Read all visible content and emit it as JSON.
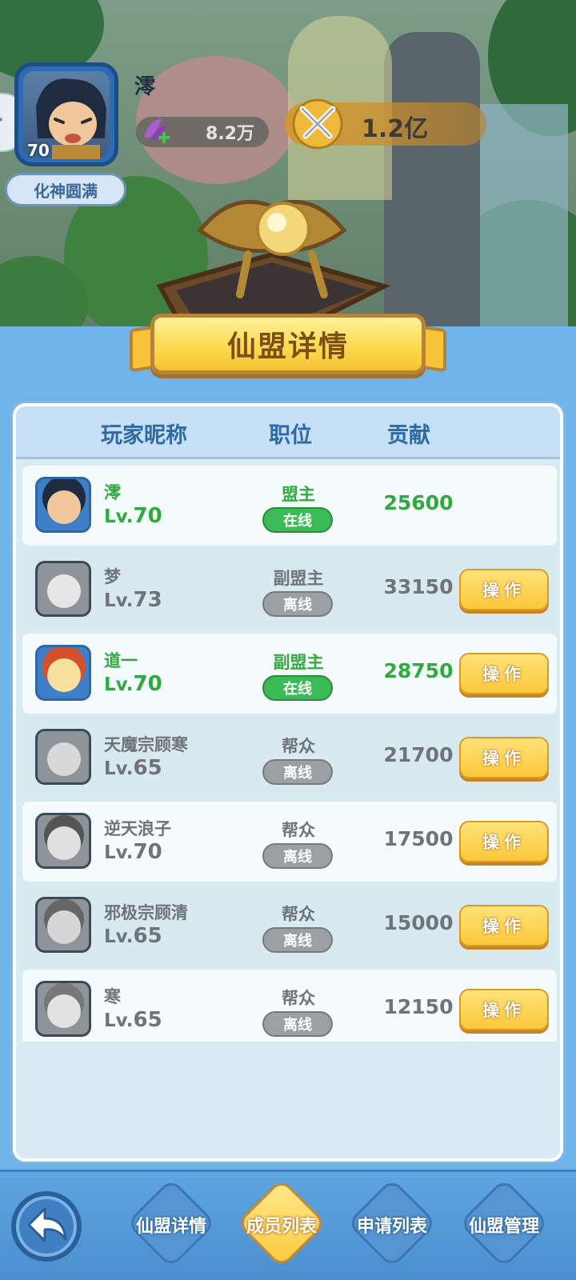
{
  "player": {
    "name": "澪",
    "level": "70",
    "realm": "化神圆满",
    "stat_value": "8.2万",
    "power_value": "1.2亿"
  },
  "banner": {
    "title": "仙盟详情"
  },
  "list": {
    "headers": {
      "name": "玩家昵称",
      "position": "职位",
      "contribution": "贡献"
    },
    "members": [
      {
        "name": "澪",
        "lv_prefix": "Lv.",
        "level": "70",
        "position": "盟主",
        "status": "在线",
        "contribution": "25600",
        "online": true,
        "has_action": false
      },
      {
        "name": "梦",
        "lv_prefix": "Lv.",
        "level": "73",
        "position": "副盟主",
        "status": "离线",
        "contribution": "33150",
        "online": false,
        "has_action": true,
        "action": "操作"
      },
      {
        "name": "道一",
        "lv_prefix": "Lv.",
        "level": "70",
        "position": "副盟主",
        "status": "在线",
        "contribution": "28750",
        "online": true,
        "has_action": true,
        "action": "操作"
      },
      {
        "name": "天魔宗顾寒",
        "lv_prefix": "Lv.",
        "level": "65",
        "position": "帮众",
        "status": "离线",
        "contribution": "21700",
        "online": false,
        "has_action": true,
        "action": "操作"
      },
      {
        "name": "逆天浪子",
        "lv_prefix": "Lv.",
        "level": "70",
        "position": "帮众",
        "status": "离线",
        "contribution": "17500",
        "online": false,
        "has_action": true,
        "action": "操作"
      },
      {
        "name": "邪极宗顾清",
        "lv_prefix": "Lv.",
        "level": "65",
        "position": "帮众",
        "status": "离线",
        "contribution": "15000",
        "online": false,
        "has_action": true,
        "action": "操作"
      },
      {
        "name": "寒",
        "lv_prefix": "Lv.",
        "level": "65",
        "position": "帮众",
        "status": "离线",
        "contribution": "12150",
        "online": false,
        "has_action": true,
        "action": "操作"
      }
    ]
  },
  "nav": {
    "tabs": [
      {
        "label": "仙盟详情",
        "active": false
      },
      {
        "label": "成员列表",
        "active": true
      },
      {
        "label": "申请列表",
        "active": false
      },
      {
        "label": "仙盟管理",
        "active": false
      }
    ]
  },
  "colors": {
    "online_green": "#2faa3d",
    "offline_grey": "#6f7479",
    "button_gold": "#fbc83a",
    "panel_blue": "#6fb4ea"
  },
  "icons": [
    "back-arrow-icon",
    "crossed-swords-icon",
    "herb-plus-icon",
    "golden-orb-artifact"
  ]
}
